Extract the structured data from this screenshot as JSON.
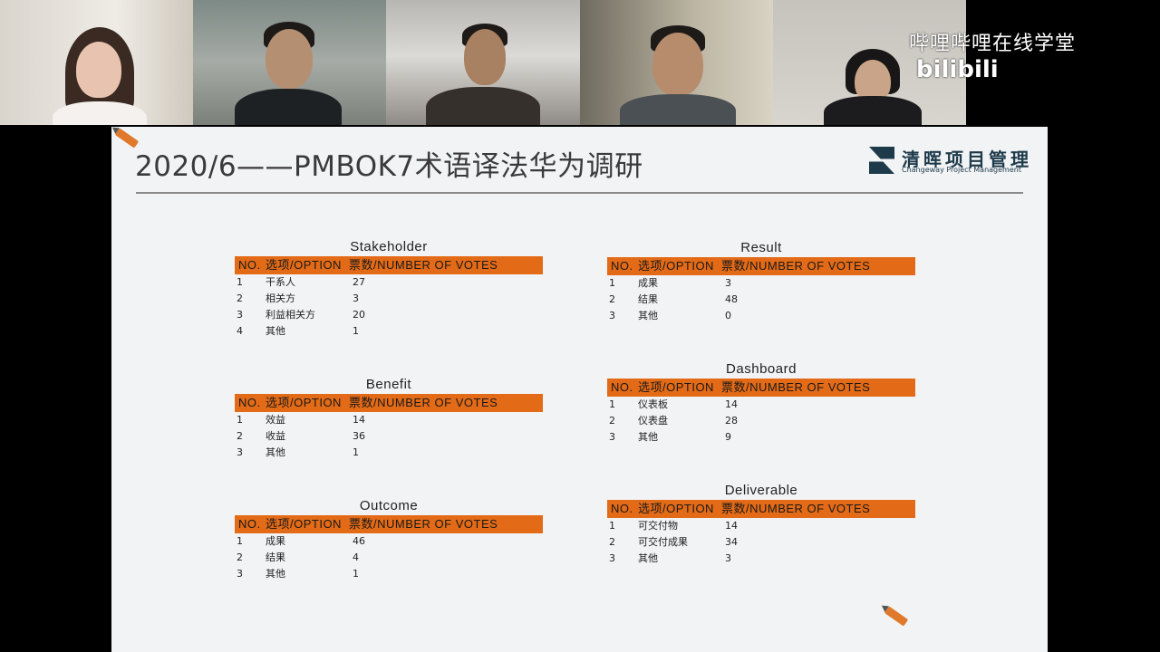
{
  "watermark": {
    "text": "哔哩哔哩在线学堂",
    "logo": "bilibili"
  },
  "slide": {
    "title": "2020/6——PMBOK7术语译法华为调研",
    "logo_cn": "清晖项目管理",
    "logo_en": "Changeway Project Management"
  },
  "header_cols": {
    "no": "NO.",
    "option": "选项/OPTION",
    "votes": "票数/NUMBER OF VOTES"
  },
  "tables": {
    "stakeholder": {
      "title": "Stakeholder",
      "rows": [
        {
          "no": "1",
          "option": "干系人",
          "votes": "27"
        },
        {
          "no": "2",
          "option": "相关方",
          "votes": "3"
        },
        {
          "no": "3",
          "option": "利益相关方",
          "votes": "20"
        },
        {
          "no": "4",
          "option": "其他",
          "votes": "1"
        }
      ]
    },
    "benefit": {
      "title": "Benefit",
      "rows": [
        {
          "no": "1",
          "option": "效益",
          "votes": "14"
        },
        {
          "no": "2",
          "option": "收益",
          "votes": "36"
        },
        {
          "no": "3",
          "option": "其他",
          "votes": "1"
        }
      ]
    },
    "outcome": {
      "title": "Outcome",
      "rows": [
        {
          "no": "1",
          "option": "成果",
          "votes": "46"
        },
        {
          "no": "2",
          "option": "结果",
          "votes": "4"
        },
        {
          "no": "3",
          "option": "其他",
          "votes": "1"
        }
      ]
    },
    "result": {
      "title": "Result",
      "rows": [
        {
          "no": "1",
          "option": "成果",
          "votes": "3"
        },
        {
          "no": "2",
          "option": "结果",
          "votes": "48"
        },
        {
          "no": "3",
          "option": "其他",
          "votes": "0"
        }
      ]
    },
    "dashboard": {
      "title": "Dashboard",
      "rows": [
        {
          "no": "1",
          "option": "仪表板",
          "votes": "14"
        },
        {
          "no": "2",
          "option": "仪表盘",
          "votes": "28"
        },
        {
          "no": "3",
          "option": "其他",
          "votes": "9"
        }
      ]
    },
    "deliverable": {
      "title": "Deliverable",
      "rows": [
        {
          "no": "1",
          "option": "可交付物",
          "votes": "14"
        },
        {
          "no": "2",
          "option": "可交付成果",
          "votes": "34"
        },
        {
          "no": "3",
          "option": "其他",
          "votes": "3"
        }
      ]
    }
  },
  "colors": {
    "header_orange": "#e36a16",
    "slide_bg": "#f2f3f5",
    "title_text": "#3a3a3a"
  }
}
